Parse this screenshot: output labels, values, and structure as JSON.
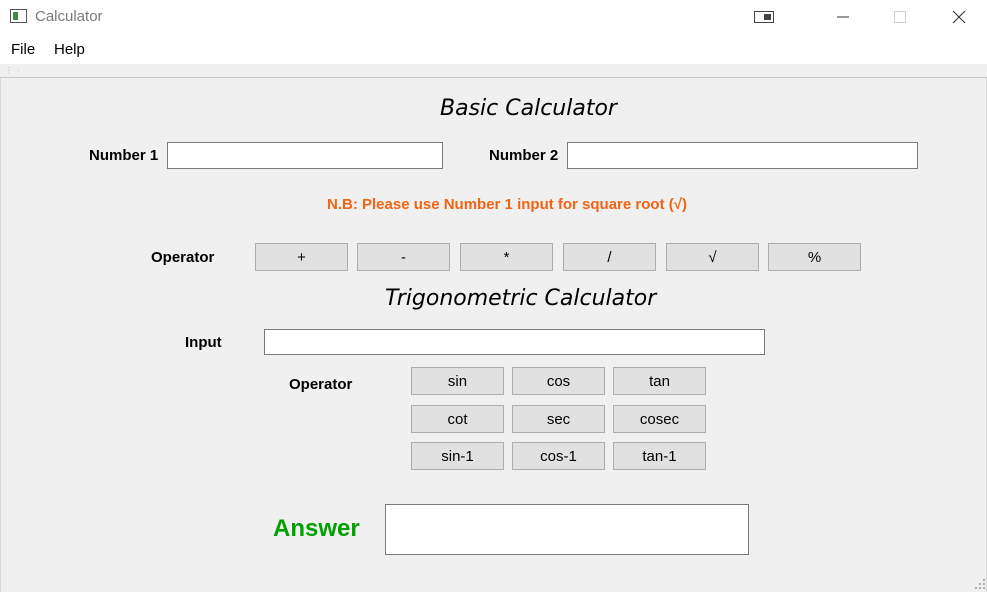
{
  "window": {
    "title": "Calculator",
    "icons": {
      "app": "calculator-app-icon",
      "snap": "snap-layout-icon",
      "minimize": "minimize-icon",
      "maximize": "maximize-icon",
      "close": "close-icon"
    }
  },
  "menu": {
    "file": "File",
    "help": "Help"
  },
  "basic": {
    "title": "Basic Calculator",
    "number1_label": "Number 1",
    "number1_value": "",
    "number2_label": "Number 2",
    "number2_value": "",
    "note": "N.B: Please use Number 1 input for square root (√)",
    "operator_label": "Operator",
    "ops": {
      "add": "+",
      "sub": "-",
      "mul": "*",
      "div": "/",
      "sqrt": "√",
      "mod": "%"
    }
  },
  "trig": {
    "title": "Trigonometric Calculator",
    "input_label": "Input",
    "input_value": "",
    "operator_label": "Operator",
    "ops": {
      "sin": "sin",
      "cos": "cos",
      "tan": "tan",
      "cot": "cot",
      "sec": "sec",
      "cosec": "cosec",
      "asin": "sin-1",
      "acos": "cos-1",
      "atan": "tan-1"
    }
  },
  "answer": {
    "label": "Answer",
    "value": ""
  },
  "colors": {
    "note": "#f06414",
    "answer": "#00a000",
    "background": "#f0f0f0"
  }
}
